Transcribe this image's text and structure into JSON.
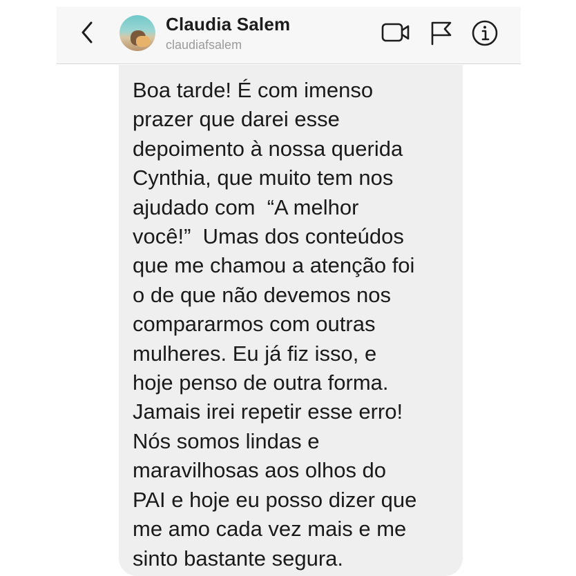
{
  "header": {
    "name": "Claudia Salem",
    "username": "claudiafsalem",
    "icons": {
      "back": "chevron-left-icon",
      "video": "video-camera-icon",
      "flag": "flag-icon",
      "info": "info-icon"
    }
  },
  "message": {
    "text": "Boa tarde! É com imenso\nprazer que darei esse\ndepoimento à nossa querida\nCynthia, que muito tem nos\najudado com  “A melhor\nvocê!”  Umas dos conteúdos\nque me chamou a atenção foi\no de que não devemos nos\ncompararmos com outras\nmulheres. Eu já fiz isso, e\nhoje penso de outra forma.\nJamais irei repetir esse erro!\nNós somos lindas e\nmaravilhosas aos olhos do\nPAI e hoje eu posso dizer que\nme amo cada vez mais e me\nsinto bastante segura."
  },
  "colors": {
    "header_bg": "#f7f7f7",
    "bubble_bg": "#efefef",
    "text": "#1a1a1a",
    "username": "#9a9a9a"
  }
}
